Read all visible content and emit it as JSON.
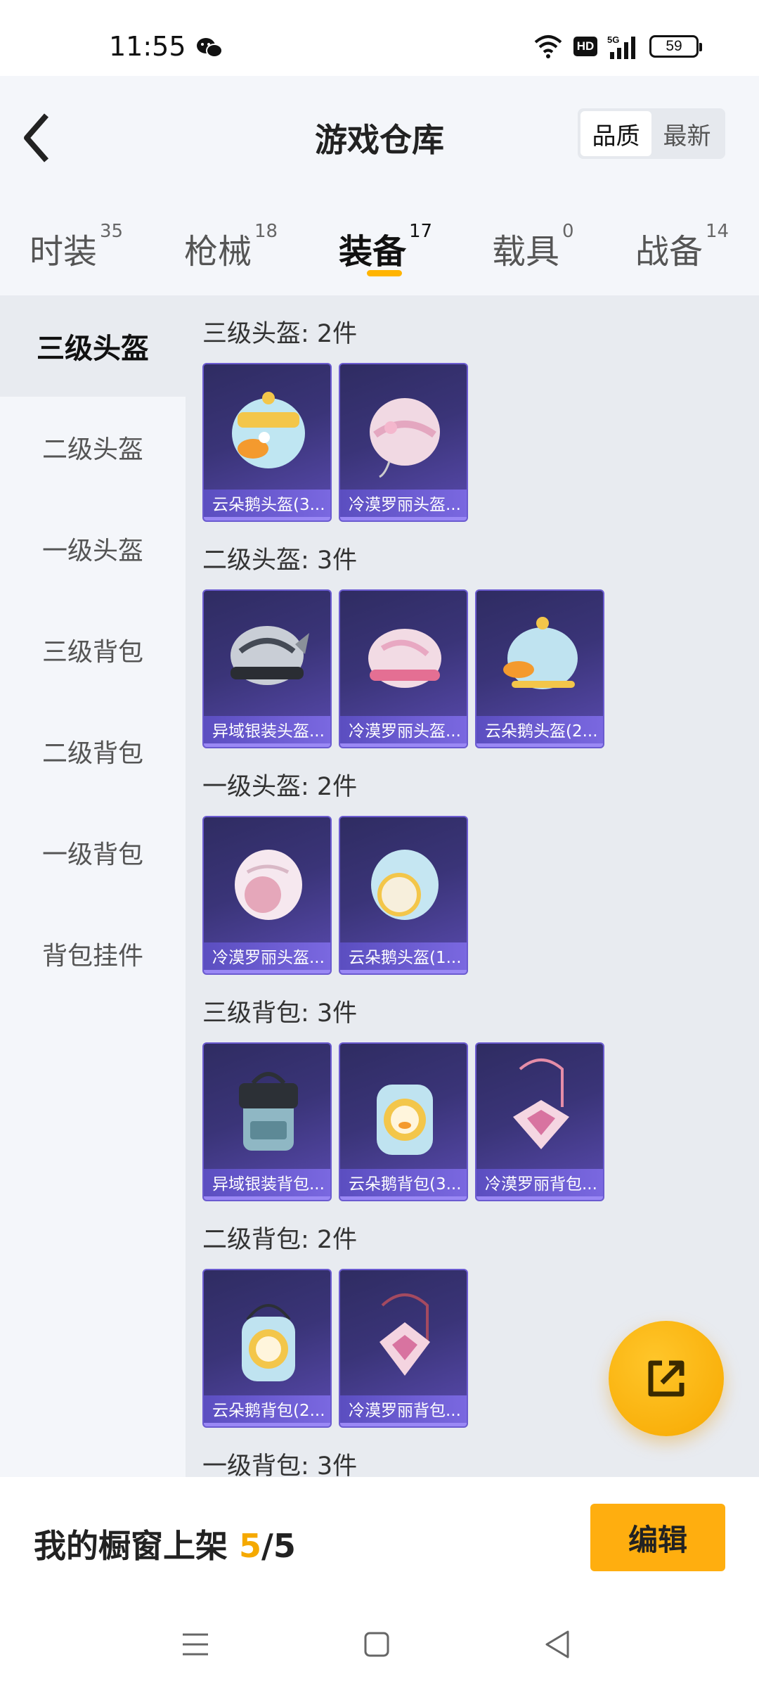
{
  "status_bar": {
    "time": "11:55",
    "network": "5G",
    "hd": "HD",
    "battery": "59"
  },
  "header": {
    "title": "游戏仓库",
    "sort_options": [
      "品质",
      "最新"
    ],
    "sort_active": "品质"
  },
  "tabs": [
    {
      "label": "时装",
      "count": "35",
      "active": false
    },
    {
      "label": "枪械",
      "count": "18",
      "active": false
    },
    {
      "label": "装备",
      "count": "17",
      "active": true
    },
    {
      "label": "载具",
      "count": "0",
      "active": false
    },
    {
      "label": "战备",
      "count": "14",
      "active": false
    }
  ],
  "sidebar": {
    "items": [
      {
        "label": "三级头盔",
        "active": true
      },
      {
        "label": "二级头盔",
        "active": false
      },
      {
        "label": "一级头盔",
        "active": false
      },
      {
        "label": "三级背包",
        "active": false
      },
      {
        "label": "二级背包",
        "active": false
      },
      {
        "label": "一级背包",
        "active": false
      },
      {
        "label": "背包挂件",
        "active": false
      }
    ]
  },
  "sections": [
    {
      "title": "三级头盔: 2件",
      "items": [
        {
          "name": "云朵鹅头盔(3...",
          "icon": "duck-helmet-icon"
        },
        {
          "name": "冷漠罗丽头盔...",
          "icon": "pink-helmet-icon"
        }
      ]
    },
    {
      "title": "二级头盔: 3件",
      "items": [
        {
          "name": "异域银装头盔...",
          "icon": "silver-helmet-icon"
        },
        {
          "name": "冷漠罗丽头盔...",
          "icon": "pink-helmet-icon"
        },
        {
          "name": "云朵鹅头盔(2...",
          "icon": "duck-helmet-icon"
        }
      ]
    },
    {
      "title": "一级头盔: 2件",
      "items": [
        {
          "name": "冷漠罗丽头盔...",
          "icon": "pink-helmet-icon"
        },
        {
          "name": "云朵鹅头盔(1...",
          "icon": "blue-helmet-icon"
        }
      ]
    },
    {
      "title": "三级背包: 3件",
      "items": [
        {
          "name": "异域银装背包...",
          "icon": "silver-backpack-icon"
        },
        {
          "name": "云朵鹅背包(3...",
          "icon": "duck-backpack-icon"
        },
        {
          "name": "冷漠罗丽背包...",
          "icon": "pink-backpack-icon"
        }
      ]
    },
    {
      "title": "二级背包: 2件",
      "items": [
        {
          "name": "云朵鹅背包(2...",
          "icon": "duck-backpack-icon"
        },
        {
          "name": "冷漠罗丽背包...",
          "icon": "pink-backpack-icon"
        }
      ]
    },
    {
      "title": "一级背包: 3件",
      "items": []
    }
  ],
  "bottom_bar": {
    "showcase_label": "我的橱窗上架 ",
    "showcase_used": "5",
    "showcase_sep": "/",
    "showcase_total": "5",
    "edit_label": "编辑"
  },
  "colors": {
    "accent": "#ffb400",
    "card_bg": "#3a3478",
    "card_label": "#6b5bd0"
  }
}
